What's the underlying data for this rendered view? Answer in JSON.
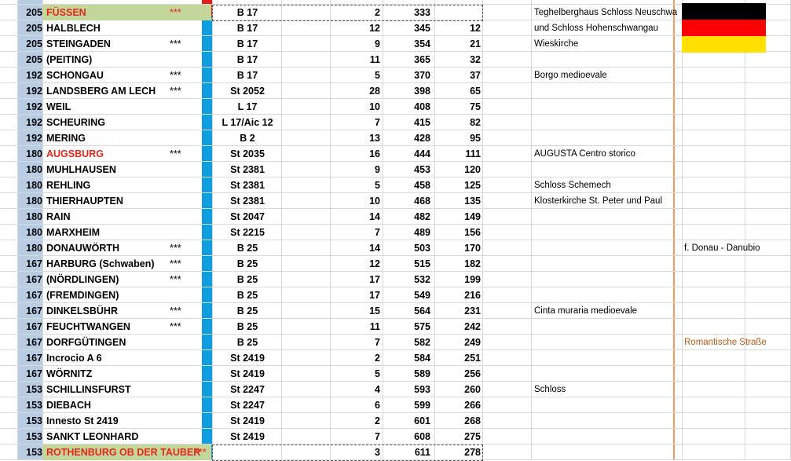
{
  "sheet": {
    "rows": [
      {
        "dist": "205",
        "name": "FÜSSEN",
        "stars": "***",
        "road": "B 17",
        "seg": "2",
        "cum": "333",
        "part": "",
        "note": "Teghelberghaus Schloss Neuschwa",
        "highlight": true
      },
      {
        "dist": "205",
        "name": "HALBLECH",
        "stars": "",
        "road": "B 17",
        "seg": "12",
        "cum": "345",
        "part": "12",
        "note": "und Schloss Hohenschwangau"
      },
      {
        "dist": "205",
        "name": "STEINGADEN",
        "stars": "***",
        "road": "B 17",
        "seg": "9",
        "cum": "354",
        "part": "21",
        "note": "Wieskirche"
      },
      {
        "dist": "205",
        "name": "(PEITING)",
        "stars": "",
        "road": "B 17",
        "seg": "11",
        "cum": "365",
        "part": "32",
        "note": ""
      },
      {
        "dist": "192",
        "name": "SCHONGAU",
        "stars": "***",
        "road": "B 17",
        "seg": "5",
        "cum": "370",
        "part": "37",
        "note": "Borgo medioevale"
      },
      {
        "dist": "192",
        "name": "LANDSBERG AM LECH",
        "stars": "***",
        "road": "St 2052",
        "seg": "28",
        "cum": "398",
        "part": "65",
        "note": ""
      },
      {
        "dist": "192",
        "name": "WEIL",
        "stars": "",
        "road": "L 17",
        "seg": "10",
        "cum": "408",
        "part": "75",
        "note": ""
      },
      {
        "dist": "192",
        "name": "SCHEURING",
        "stars": "",
        "road": "L 17/Aic 12",
        "seg": "7",
        "cum": "415",
        "part": "82",
        "note": ""
      },
      {
        "dist": "192",
        "name": "MERING",
        "stars": "",
        "road": "B 2",
        "seg": "13",
        "cum": "428",
        "part": "95",
        "note": ""
      },
      {
        "dist": "180",
        "name": "AUGSBURG",
        "stars": "***",
        "road": "St 2035",
        "seg": "16",
        "cum": "444",
        "part": "111",
        "note": "AUGUSTA Centro storico",
        "red": true
      },
      {
        "dist": "180",
        "name": "MUHLHAUSEN",
        "stars": "",
        "road": "St 2381",
        "seg": "9",
        "cum": "453",
        "part": "120",
        "note": ""
      },
      {
        "dist": "180",
        "name": "REHLING",
        "stars": "",
        "road": "St 2381",
        "seg": "5",
        "cum": "458",
        "part": "125",
        "note": " Schloss Schemech"
      },
      {
        "dist": "180",
        "name": "THIERHAUPTEN",
        "stars": "",
        "road": "St 2381",
        "seg": "10",
        "cum": "468",
        "part": "135",
        "note": "Klosterkirche St. Peter und Paul"
      },
      {
        "dist": "180",
        "name": "RAIN",
        "stars": "",
        "road": "St 2047",
        "seg": "14",
        "cum": "482",
        "part": "149",
        "note": ""
      },
      {
        "dist": "180",
        "name": "MARXHEIM",
        "stars": "",
        "road": "St 2215",
        "seg": "7",
        "cum": "489",
        "part": "156",
        "note": ""
      },
      {
        "dist": "180",
        "name": "DONAUWÖRTH",
        "stars": "***",
        "road": "B 25",
        "seg": "14",
        "cum": "503",
        "part": "170",
        "note": "",
        "extra": "f. Donau - Danubio"
      },
      {
        "dist": "167",
        "name": "HARBURG (Schwaben)",
        "stars": "***",
        "road": "B 25",
        "seg": "12",
        "cum": "515",
        "part": "182",
        "note": ""
      },
      {
        "dist": "167",
        "name": "(NÖRDLINGEN)",
        "stars": "***",
        "road": "B 25",
        "seg": "17",
        "cum": "532",
        "part": "199",
        "note": ""
      },
      {
        "dist": "167",
        "name": "(FREMDINGEN)",
        "stars": "",
        "road": "B 25",
        "seg": "17",
        "cum": "549",
        "part": "216",
        "note": ""
      },
      {
        "dist": "167",
        "name": "DINKELSBÜHR",
        "stars": "***",
        "road": "B 25",
        "seg": "15",
        "cum": "564",
        "part": "231",
        "note": "Cinta muraria medioevale"
      },
      {
        "dist": "167",
        "name": "FEUCHTWANGEN",
        "stars": "***",
        "road": "B 25",
        "seg": "11",
        "cum": "575",
        "part": "242",
        "note": ""
      },
      {
        "dist": "167",
        "name": "DORFGÜTINGEN",
        "stars": "",
        "road": "B 25",
        "seg": "7",
        "cum": "582",
        "part": "249",
        "note": "",
        "extra": "Romantische Straße",
        "extraOrange": true
      },
      {
        "dist": "167",
        "name": "Incrocio A 6",
        "stars": "",
        "road": "St 2419",
        "seg": "2",
        "cum": "584",
        "part": "251",
        "note": ""
      },
      {
        "dist": "167",
        "name": "WÖRNITZ",
        "stars": "",
        "road": "St 2419",
        "seg": "5",
        "cum": "589",
        "part": "256",
        "note": ""
      },
      {
        "dist": "153",
        "name": "SCHILLINSFURST",
        "stars": "",
        "road": "St 2247",
        "seg": "4",
        "cum": "593",
        "part": "260",
        "note": "Schloss"
      },
      {
        "dist": "153",
        "name": "DIEBACH",
        "stars": "",
        "road": "St 2247",
        "seg": "6",
        "cum": "599",
        "part": "266",
        "note": ""
      },
      {
        "dist": "153",
        "name": "Innesto St 2419",
        "stars": "",
        "road": "St 2419",
        "seg": "2",
        "cum": "601",
        "part": "268",
        "note": ""
      },
      {
        "dist": "153",
        "name": "SANKT LEONHARD",
        "stars": "",
        "road": "St 2419",
        "seg": "7",
        "cum": "608",
        "part": "275",
        "note": ""
      },
      {
        "dist": "153",
        "name": "ROTHENBURG OB DER TAUBER",
        "stars": "***",
        "road": "",
        "seg": "3",
        "cum": "611",
        "part": "278",
        "note": "",
        "highlight": true
      }
    ]
  },
  "flag": {
    "colors": [
      "#000000",
      "#ff0000",
      "#ffe000"
    ]
  },
  "colors": {
    "red_text": "#e8251b",
    "green_fill": "#c4d79b",
    "blue_band": "#0d9ee0",
    "col_a": "#b8cce4",
    "orange_line": "#f29a5d"
  }
}
